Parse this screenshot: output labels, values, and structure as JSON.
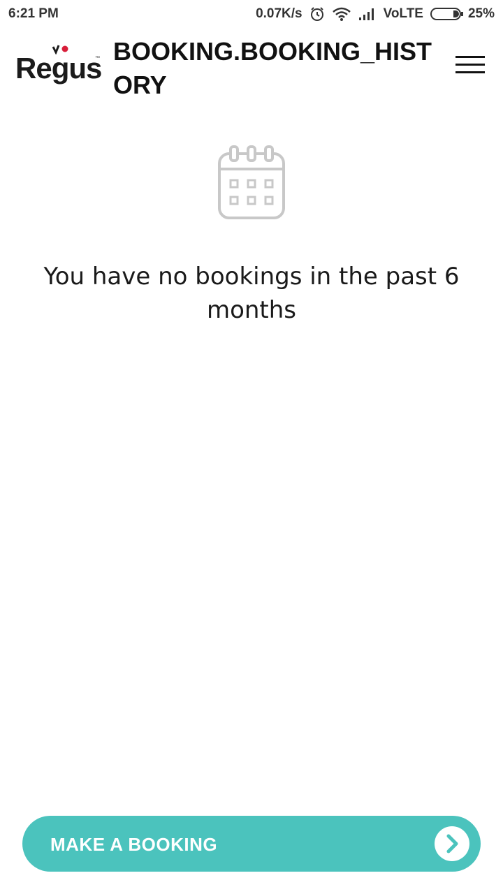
{
  "status_bar": {
    "time": "6:21 PM",
    "net_speed": "0.07K/s",
    "network": "VoLTE",
    "battery": "25%",
    "icons": [
      "alarm-icon",
      "wifi-icon",
      "signal-icon",
      "battery-icon"
    ]
  },
  "header": {
    "logo_text": "Regus",
    "logo_tm": "™",
    "title": "BOOKING.BOOKING_HISTORY",
    "menu_icon": "hamburger-menu-icon"
  },
  "empty_state": {
    "icon": "calendar-icon",
    "message": "You have no bookings in the past 6 months"
  },
  "footer": {
    "button_label": "MAKE A BOOKING",
    "button_icon": "chevron-right-icon"
  },
  "colors": {
    "accent": "#4bc3bd",
    "logo_dot_red": "#d81e3a",
    "text": "#1a1a1a",
    "icon_gray": "#c8c8c8"
  }
}
